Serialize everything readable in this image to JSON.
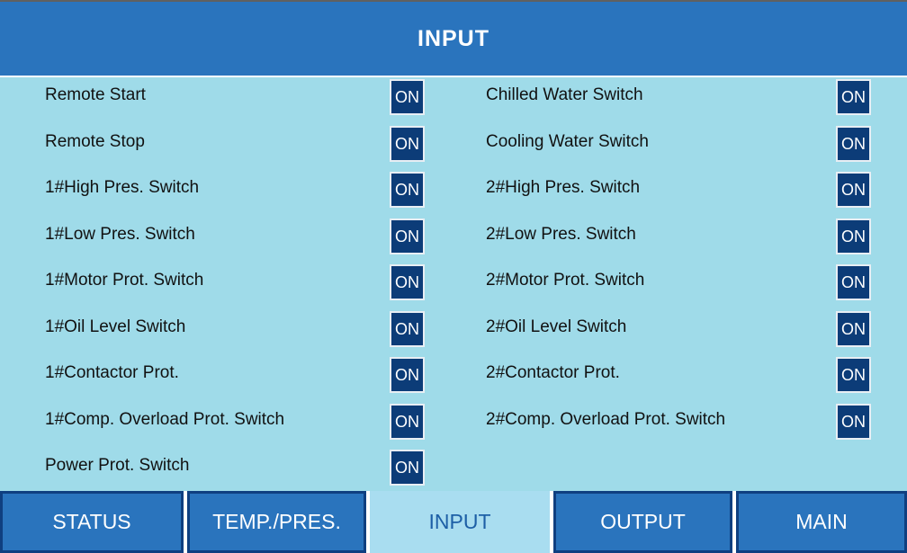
{
  "header": {
    "title": "INPUT"
  },
  "left_items": [
    {
      "label": "Remote Start",
      "state": "ON"
    },
    {
      "label": "Remote Stop",
      "state": "ON"
    },
    {
      "label": "1#High Pres. Switch",
      "state": "ON"
    },
    {
      "label": "1#Low Pres. Switch",
      "state": "ON"
    },
    {
      "label": "1#Motor Prot. Switch",
      "state": "ON"
    },
    {
      "label": "1#Oil Level Switch",
      "state": "ON"
    },
    {
      "label": "1#Contactor Prot.",
      "state": "ON"
    },
    {
      "label": "1#Comp. Overload Prot. Switch",
      "state": "ON"
    },
    {
      "label": "Power Prot. Switch",
      "state": "ON"
    }
  ],
  "right_items": [
    {
      "label": "Chilled Water Switch",
      "state": "ON"
    },
    {
      "label": "Cooling Water Switch",
      "state": "ON"
    },
    {
      "label": "2#High Pres. Switch",
      "state": "ON"
    },
    {
      "label": "2#Low Pres. Switch",
      "state": "ON"
    },
    {
      "label": "2#Motor Prot. Switch",
      "state": "ON"
    },
    {
      "label": "2#Oil Level Switch",
      "state": "ON"
    },
    {
      "label": "2#Contactor Prot.",
      "state": "ON"
    },
    {
      "label": "2#Comp. Overload Prot. Switch",
      "state": "ON"
    }
  ],
  "nav": {
    "tabs": [
      {
        "label": "STATUS",
        "active": false
      },
      {
        "label": "TEMP./PRES.",
        "active": false
      },
      {
        "label": "INPUT",
        "active": true
      },
      {
        "label": "OUTPUT",
        "active": false
      },
      {
        "label": "MAIN",
        "active": false
      }
    ]
  },
  "colors": {
    "background": "#9fdbe9",
    "header": "#2a74bd",
    "state_box": "#0c3c78",
    "tab": "#2a74bd",
    "tab_active": "#a9ddf0"
  }
}
